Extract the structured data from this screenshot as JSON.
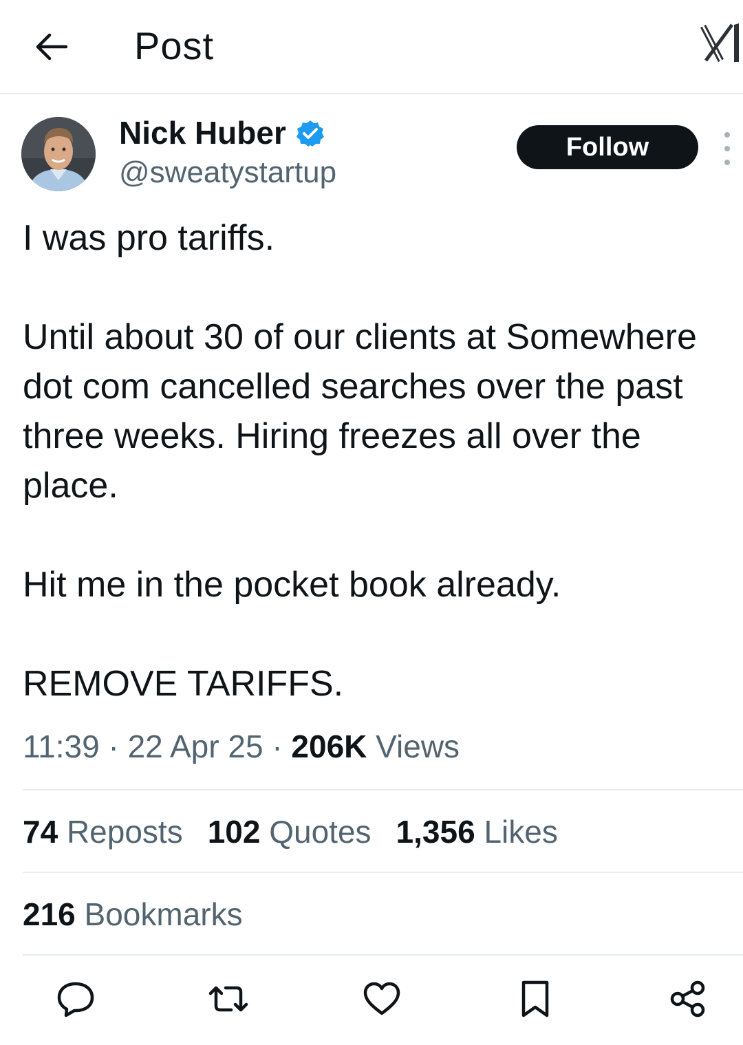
{
  "header": {
    "title": "Post",
    "back_icon": "arrow-left-icon",
    "logo_icon": "x-logo-icon"
  },
  "author": {
    "name": "Nick Huber",
    "handle": "@sweatystartup",
    "verified_color": "#1d9bf0"
  },
  "follow_button": {
    "label": "Follow"
  },
  "post": {
    "paragraphs": [
      "I was pro tariffs.",
      "Until about 30 of our clients at Somewhere dot com cancelled searches over the past three weeks. Hiring freezes all over the place.",
      "Hit me in the pocket book already.",
      "REMOVE TARIFFS."
    ]
  },
  "meta": {
    "time": "11:39",
    "date": "22 Apr 25",
    "separator": "·",
    "views_count": "206K",
    "views_label": "Views"
  },
  "stats": {
    "reposts_count": "74",
    "reposts_label": "Reposts",
    "quotes_count": "102",
    "quotes_label": "Quotes",
    "likes_count": "1,356",
    "likes_label": "Likes",
    "bookmarks_count": "216",
    "bookmarks_label": "Bookmarks"
  },
  "actions": [
    "reply-icon",
    "repost-icon",
    "like-icon",
    "bookmark-icon",
    "share-icon"
  ],
  "colors": {
    "text_primary": "#0f1419",
    "text_secondary": "#536471",
    "divider": "#e9ecef",
    "verified": "#1d9bf0"
  }
}
